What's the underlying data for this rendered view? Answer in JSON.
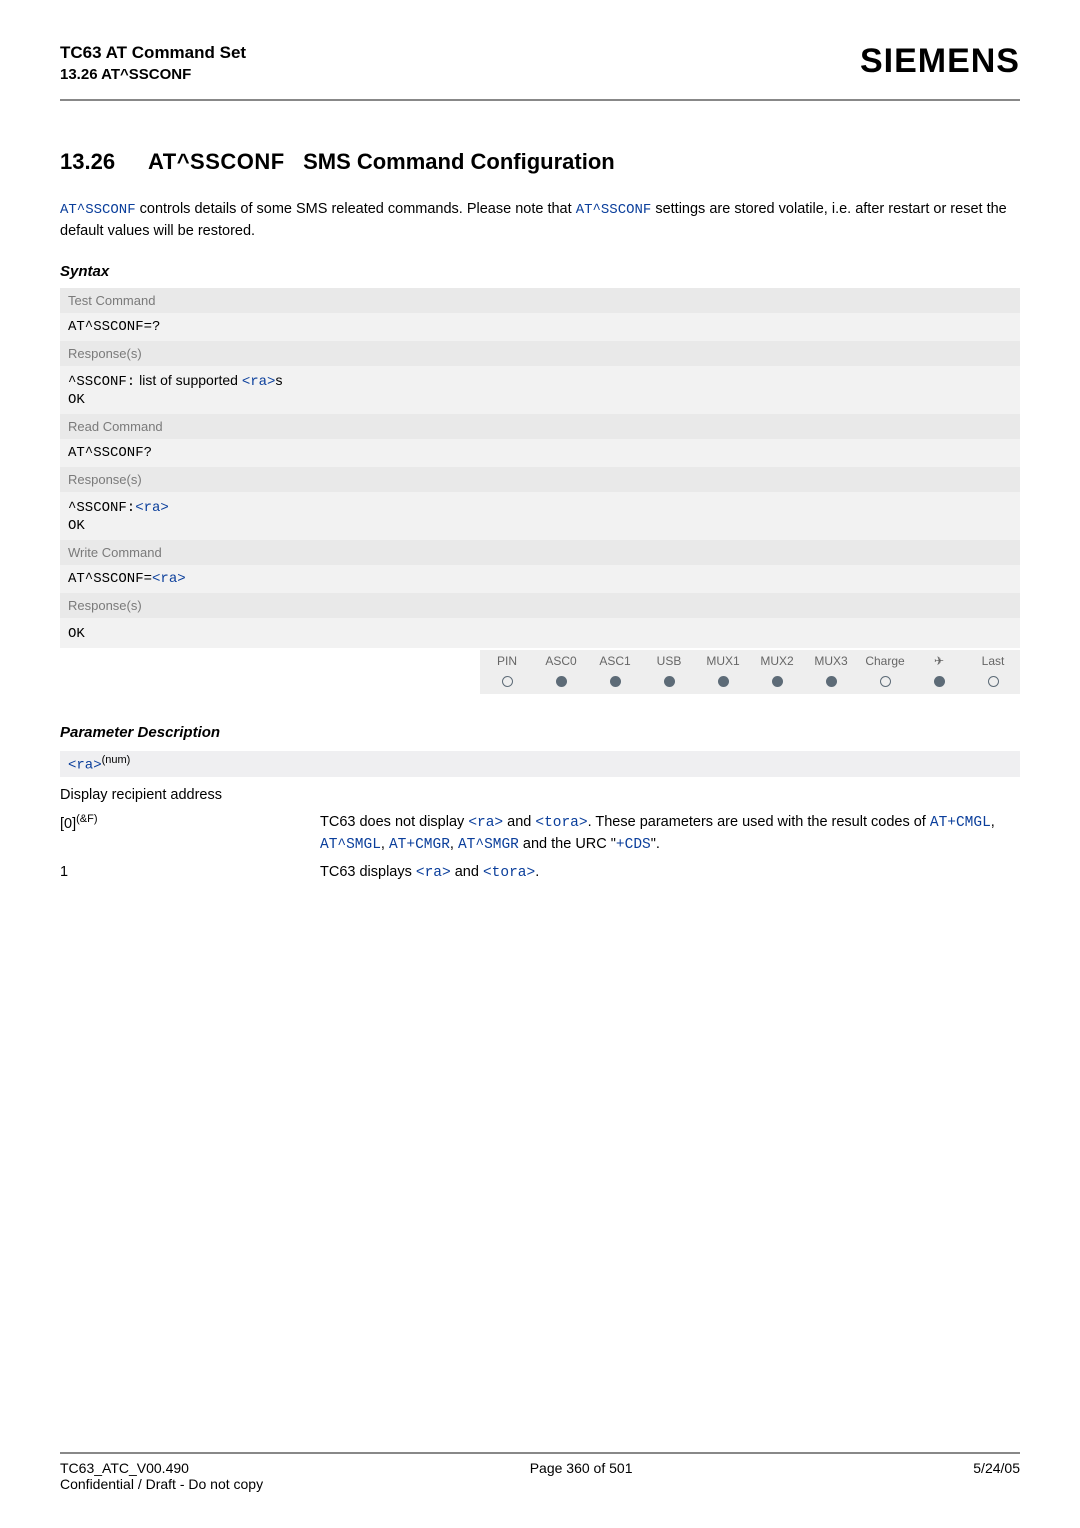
{
  "header": {
    "title": "TC63 AT Command Set",
    "sub": "13.26 AT^SSCONF",
    "brand": "SIEMENS"
  },
  "section": {
    "num": "13.26",
    "cmd": "AT^SSCONF",
    "title": "SMS Command Configuration"
  },
  "intro": {
    "cmd": "AT^SSCONF",
    "text1": " controls details of some SMS releated commands. Please note that ",
    "cmd2": "AT^SSCONF",
    "text2": " settings are stored volatile, i.e. after restart or reset the default values will be restored."
  },
  "syntax_label": "Syntax",
  "blocks": {
    "test": {
      "label": "Test Command",
      "cmd": "AT^SSCONF=?",
      "resp_label": "Response(s)",
      "resp_prefix": "^SSCONF:",
      "resp_mid": "list of supported ",
      "resp_link": "<ra>",
      "resp_suffix": "s",
      "ok": "OK"
    },
    "read": {
      "label": "Read Command",
      "cmd": "AT^SSCONF?",
      "resp_label": "Response(s)",
      "resp_prefix": "^SSCONF:",
      "resp_link": "<ra>",
      "ok": "OK"
    },
    "write": {
      "label": "Write Command",
      "cmd_prefix": "AT^SSCONF=",
      "cmd_link": "<ra>",
      "resp_label": "Response(s)",
      "ok": "OK"
    }
  },
  "caps": {
    "headers": [
      "PIN",
      "ASC0",
      "ASC1",
      "USB",
      "MUX1",
      "MUX2",
      "MUX3",
      "Charge",
      "✈",
      "Last"
    ],
    "values": [
      "empty",
      "full",
      "full",
      "full",
      "full",
      "full",
      "full",
      "empty",
      "full",
      "empty"
    ]
  },
  "param_label": "Parameter Description",
  "param_name": "<ra>",
  "param_sup": "(num)",
  "param_desc": "Display recipient address",
  "rows": {
    "r0": {
      "left": "[0]",
      "left_sup": "(&F)",
      "t1": "TC63 does not display ",
      "ra": "<ra>",
      "and": " and ",
      "tora": "<tora>",
      "t2": ". These parameters are used with the result codes of ",
      "c1": "AT+CMGL",
      "c2": "AT^SMGL",
      "c3": "AT+CMGR",
      "c4": "AT^SMGR",
      "t3": " and the URC \"",
      "c5": "+CDS",
      "t4": "\"."
    },
    "r1": {
      "left": "1",
      "t1": "TC63 displays ",
      "ra": "<ra>",
      "and": " and ",
      "tora": "<tora>",
      "t2": "."
    }
  },
  "footer": {
    "left": "TC63_ATC_V00.490",
    "center": "Page 360 of 501",
    "right": "5/24/05",
    "sub": "Confidential / Draft - Do not copy"
  }
}
